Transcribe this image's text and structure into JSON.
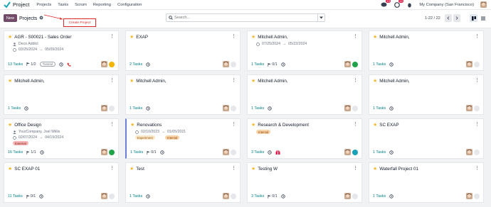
{
  "topbar": {
    "app_name": "Project",
    "menu": [
      "Projects",
      "Tasks",
      "Scrum",
      "Reporting",
      "Configuration"
    ],
    "chat_count": "13",
    "activity_count": "12",
    "company": "My Company (San Francisco)"
  },
  "control": {
    "new_label": "New",
    "title": "Projects",
    "search_placeholder": "Search...",
    "pager": "1-22 / 22",
    "tooltip": "Create Project"
  },
  "colors": {
    "accent": "#714b67",
    "tasks": "#017e84",
    "star": "#f3b82a",
    "green": "#22a34a",
    "yellow": "#f5b400",
    "grey": "#e5e7eb",
    "teal": "#17a2b8"
  },
  "cards": [
    {
      "title": "AGR - S00021 - Sales Order",
      "customer": "Deco Addict",
      "dates": [
        "03/25/2024",
        "05/09/2024"
      ],
      "tasks": "13 Tasks",
      "milestones": "1/2",
      "tag": "Tutorial",
      "status": "yellow",
      "extra": "phone-icon"
    },
    {
      "title": "EXAP",
      "tasks": "2 Tasks",
      "status": "grey"
    },
    {
      "title": "Mitchell Admin,",
      "dates": [
        "07/25/2024",
        "05/22/2024"
      ],
      "tasks": "1 Tasks",
      "milestones": "0/1",
      "status": "green"
    },
    {
      "title": "Mitchell Admin,",
      "tasks": "1 Tasks",
      "status": "grey"
    },
    {
      "title": "Mitchell Admin,",
      "tasks": "1 Tasks",
      "status": "grey"
    },
    {
      "title": "Mitchell Admin,",
      "tasks": "1 Tasks",
      "status": "grey"
    },
    {
      "title": "Mitchell Admin,",
      "tasks": "1 Tasks",
      "status": "grey"
    },
    {
      "title": "Mitchell Admin,",
      "tasks": "1 Tasks",
      "status": "grey"
    },
    {
      "title": "Office Design",
      "customer": "YourCompany, Joel Willis",
      "dates": [
        "02/07/2024",
        "04/19/2024"
      ],
      "tasks": "16 Tasks",
      "milestones": "1/1",
      "tag": "External",
      "status": "green"
    },
    {
      "title": "Renovations",
      "dates": [
        "02/10/2023",
        "01/05/2021"
      ],
      "tasks": "1 Tasks",
      "milestones": "0/1",
      "tags": [
        "Experiment",
        "Internal"
      ],
      "status": "grey"
    },
    {
      "title": "Research & Development",
      "tags": [
        "Internal"
      ],
      "tasks": "3 Tasks",
      "status": "teal",
      "extra": "gift-icon"
    },
    {
      "title": "SC EXAP",
      "tasks": "1 Tasks",
      "status": "grey"
    },
    {
      "title": "SC EXAP 01",
      "tasks": "11 Tasks",
      "milestones": "0/1",
      "status": "grey"
    },
    {
      "title": "Test",
      "tasks": "1 Tasks",
      "status": "grey"
    },
    {
      "title": "Testing W",
      "tasks": "3 Tasks",
      "milestones": "0/1",
      "status": "grey"
    },
    {
      "title": "Waterfall Project 01",
      "tasks": "1 Tasks",
      "status": "grey"
    }
  ]
}
